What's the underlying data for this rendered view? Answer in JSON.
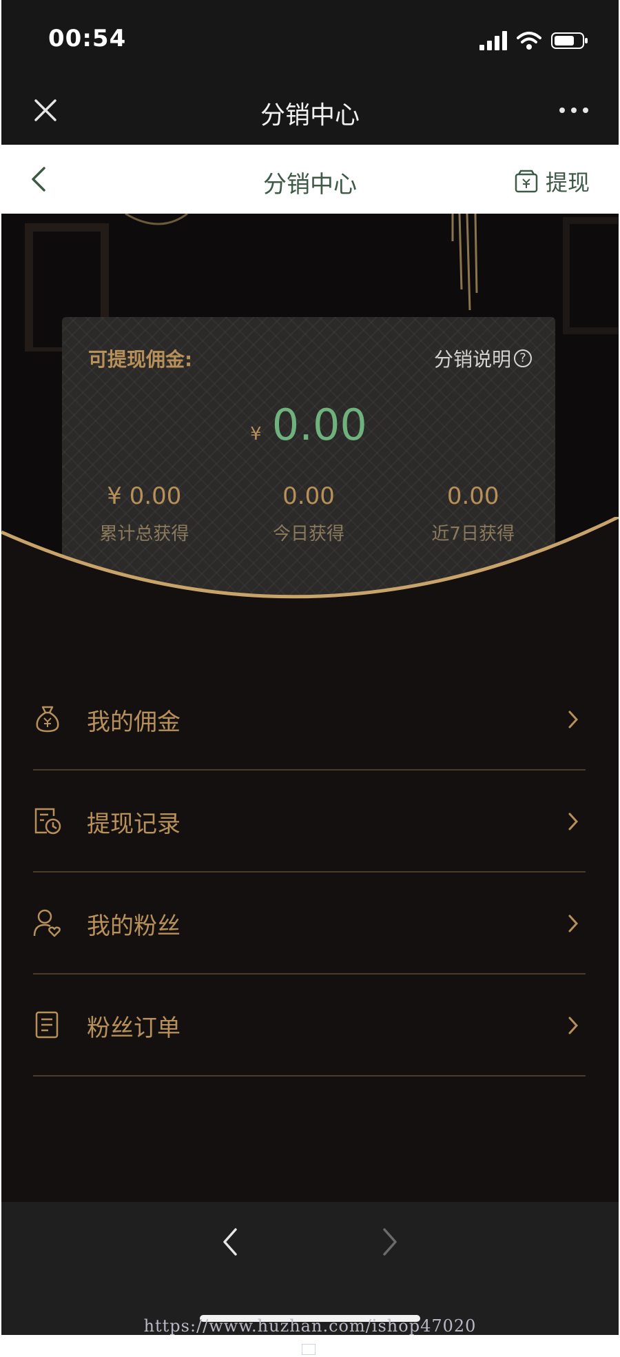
{
  "status_bar": {
    "time": "00:54"
  },
  "wechat_bar": {
    "title": "分销中心"
  },
  "app_header": {
    "title": "分销中心",
    "withdraw_label": "提现"
  },
  "card": {
    "label": "可提现佣金:",
    "help_label": "分销说明",
    "help_mark": "?",
    "currency": "¥",
    "amount": "0.00",
    "stats": [
      {
        "value": "¥ 0.00",
        "label": "累计总获得"
      },
      {
        "value": "0.00",
        "label": "今日获得"
      },
      {
        "value": "0.00",
        "label": "近7日获得"
      }
    ]
  },
  "menu": [
    {
      "label": "我的佣金",
      "icon": "money-bag-icon"
    },
    {
      "label": "提现记录",
      "icon": "history-icon"
    },
    {
      "label": "我的粉丝",
      "icon": "user-heart-icon"
    },
    {
      "label": "粉丝订单",
      "icon": "document-icon"
    }
  ],
  "watermark": "https://www.huzhan.com/ishop47020",
  "colors": {
    "gold": "#b8915a",
    "green": "#6fb27e",
    "header_green": "#3d5a46",
    "bg": "#141010"
  }
}
